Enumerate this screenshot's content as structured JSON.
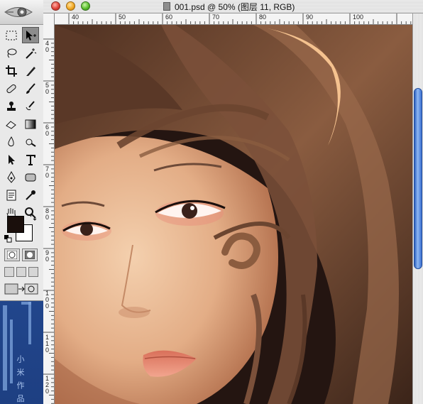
{
  "window": {
    "title": "001.psd @ 50% (图层 11, RGB)",
    "zoom": "50%",
    "layer": "图层 11",
    "color_mode": "RGB"
  },
  "rulers": {
    "top": [
      "40",
      "50",
      "60",
      "70",
      "80",
      "90",
      "100"
    ],
    "left": [
      "40",
      "50",
      "60",
      "70",
      "80",
      "90",
      "100",
      "110",
      "120"
    ]
  },
  "toolbox": {
    "tools": [
      "marquee-tool",
      "move-tool",
      "lasso-tool",
      "magic-wand-tool",
      "crop-tool",
      "slice-tool",
      "healing-brush-tool",
      "brush-tool",
      "clone-stamp-tool",
      "history-brush-tool",
      "eraser-tool",
      "gradient-tool",
      "blur-tool",
      "dodge-tool",
      "path-selection-tool",
      "type-tool",
      "pen-tool",
      "shape-tool",
      "notes-tool",
      "eyedropper-tool",
      "hand-tool",
      "zoom-tool"
    ],
    "active_tool": "move-tool",
    "foreground_color": "#1a0f0c",
    "background_color": "#ffffff"
  },
  "desktop": {
    "watermark_glyphs": "小 米 作 品"
  },
  "colors": {
    "scroll_accent": "#3a6fd0",
    "hair": "#6b4530",
    "skin": "#e6b48f",
    "background": "#241511"
  }
}
